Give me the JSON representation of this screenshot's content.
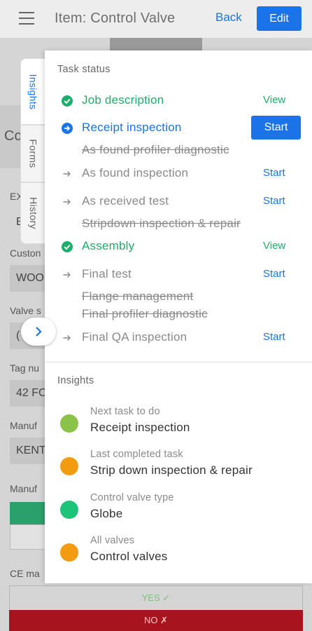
{
  "header": {
    "title": "Item: Control Valve",
    "back_label": "Back",
    "edit_label": "Edit",
    "menu_icon": "hamburger-menu-icon"
  },
  "background_form": {
    "card_text": "Co",
    "fields": [
      {
        "label": "EX",
        "value": "E"
      },
      {
        "label": "Custon",
        "value": "WOO"
      },
      {
        "label": "Valve s",
        "value": "("
      },
      {
        "label": "Tag nu",
        "value": "42 FC"
      },
      {
        "label": "Manuf",
        "value": "KENT"
      },
      {
        "label": "Manuf",
        "value": ""
      }
    ],
    "ce_label": "CE ma",
    "yes_label": "YES  ✓",
    "no_label": "NO  ✗"
  },
  "side_tabs": {
    "insights": "Insights",
    "forms": "Forms",
    "history": "History"
  },
  "task_status": {
    "title": "Task status",
    "tasks": [
      {
        "label": "Job description",
        "state": "done",
        "action": "View"
      },
      {
        "label": "Receipt inspection",
        "state": "current",
        "action": "Start"
      },
      {
        "label": "As found profiler diagnostic",
        "state": "skipped",
        "action": ""
      },
      {
        "label": "As found inspection",
        "state": "todo",
        "action": "Start"
      },
      {
        "label": "As received test",
        "state": "todo",
        "action": "Start"
      },
      {
        "label": "Stripdown inspection & repair",
        "state": "skipped",
        "action": ""
      },
      {
        "label": "Assembly",
        "state": "done",
        "action": "View"
      },
      {
        "label": "Final test",
        "state": "todo",
        "action": "Start"
      },
      {
        "label": "Flange management",
        "state": "skipped",
        "action": ""
      },
      {
        "label": "Final profiler diagnostic",
        "state": "skipped",
        "action": ""
      },
      {
        "label": "Final QA inspection",
        "state": "todo",
        "action": "Start"
      }
    ]
  },
  "insights": {
    "title": "Insights",
    "items": [
      {
        "caption": "Next task to do",
        "value": "Receipt inspection",
        "color": "#8bc34a"
      },
      {
        "caption": "Last completed task",
        "value": "Strip down inspection & repair",
        "color": "#f39c12"
      },
      {
        "caption": "Control valve type",
        "value": "Globe",
        "color": "#1cc47a"
      },
      {
        "caption": "All valves",
        "value": "Control valves",
        "color": "#f39c12"
      }
    ]
  },
  "colors": {
    "primary": "#1a73e8",
    "done": "#1cae6a",
    "muted": "#8a8a8a"
  }
}
